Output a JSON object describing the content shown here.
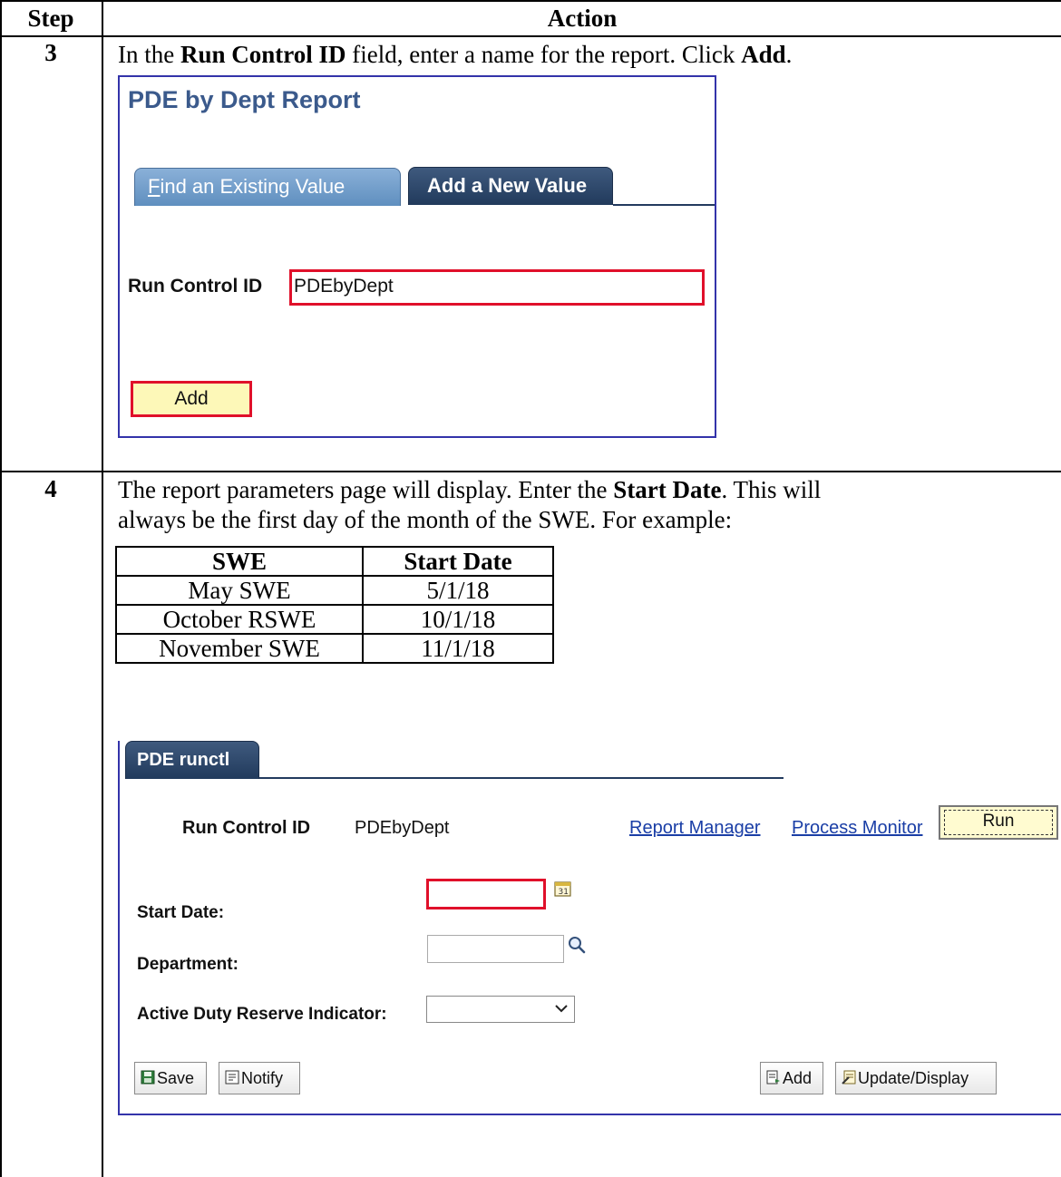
{
  "table_header": {
    "step": "Step",
    "action": "Action"
  },
  "step3": {
    "number": "3",
    "instruction_pre": "In the ",
    "instruction_bold1": "Run Control ID",
    "instruction_mid": " field, enter a name for the report.  Click ",
    "instruction_bold2": "Add",
    "instruction_post": ".",
    "panel": {
      "title": "PDE by Dept Report",
      "tabs": [
        {
          "label": "Find an Existing Value",
          "accel": "F",
          "rest": "ind an Existing Value",
          "active": false
        },
        {
          "label": "Add a New Value",
          "active": true
        }
      ],
      "run_control_label": "Run Control ID",
      "run_control_value": "PDEbyDept",
      "add_button": "Add"
    }
  },
  "step4": {
    "number": "4",
    "line1_pre": "The report parameters page will display.  Enter the ",
    "line1_bold": "Start Date",
    "line1_post": ".  This will",
    "line2": "always be the first day of the month of the SWE.  For example:",
    "example_table": {
      "headers": [
        "SWE",
        "Start Date"
      ],
      "rows": [
        [
          "May SWE",
          "5/1/18"
        ],
        [
          "October RSWE",
          "10/1/18"
        ],
        [
          "November SWE",
          "11/1/18"
        ]
      ]
    },
    "panel": {
      "tab": "PDE runctl",
      "run_control_label": "Run Control ID",
      "run_control_value": "PDEbyDept",
      "links": [
        "Report Manager",
        "Process Monitor"
      ],
      "run_button": "Run",
      "fields": {
        "start_date": "Start Date:",
        "department": "Department:",
        "active_duty": "Active Duty Reserve Indicator:"
      },
      "calendar_day": "31",
      "buttons": {
        "save": "Save",
        "notify": "Notify",
        "add": "Add",
        "update": "Update/Display"
      }
    }
  },
  "colors": {
    "highlight_red": "#e0102a",
    "ps_title_blue": "#3b5a8c",
    "link_blue": "#1a3ea6",
    "button_yellow": "#fdf8b8",
    "panel_border": "#3333aa"
  }
}
